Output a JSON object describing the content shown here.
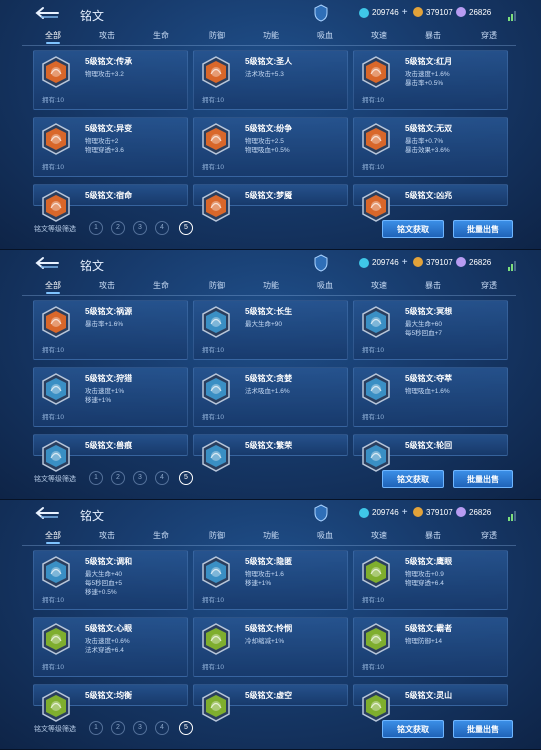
{
  "panels": [
    {
      "title": "铭文",
      "currency": {
        "coins": "209746",
        "gold": "379107",
        "gems": "26826"
      },
      "tabs": [
        "全部",
        "攻击",
        "生命",
        "防御",
        "功能",
        "吸血",
        "攻速",
        "暴击",
        "穿透"
      ],
      "runes": [
        {
          "name": "5级铭文:传承",
          "stats": [
            "物理攻击+3.2"
          ],
          "owned": "拥有:10",
          "color": "#d9672a"
        },
        {
          "name": "5级铭文:圣人",
          "stats": [
            "法术攻击+5.3"
          ],
          "owned": "拥有:10",
          "color": "#d9672a"
        },
        {
          "name": "5级铭文:红月",
          "stats": [
            "攻击速度+1.6%",
            "暴击率+0.5%"
          ],
          "owned": "拥有:10",
          "color": "#d9672a"
        },
        {
          "name": "5级铭文:异变",
          "stats": [
            "物理攻击+2",
            "物理穿透+3.6"
          ],
          "owned": "拥有:10",
          "color": "#d9672a"
        },
        {
          "name": "5级铭文:纷争",
          "stats": [
            "物理攻击+2.5",
            "物理吸血+0.5%"
          ],
          "owned": "拥有:10",
          "color": "#d9672a"
        },
        {
          "name": "5级铭文:无双",
          "stats": [
            "暴击率+0.7%",
            "暴击效果+3.6%"
          ],
          "owned": "拥有:10",
          "color": "#d9672a"
        },
        {
          "name": "5级铭文:宿命",
          "stats": [],
          "owned": "",
          "color": "#d9672a"
        },
        {
          "name": "5级铭文:梦魇",
          "stats": [],
          "owned": "",
          "color": "#d9672a"
        },
        {
          "name": "5级铭文:凶兆",
          "stats": [],
          "owned": "",
          "color": "#d9672a"
        }
      ],
      "filter_label": "铭文等级筛选",
      "levels": [
        "1",
        "2",
        "3",
        "4",
        "5"
      ],
      "btn_obtain": "铭文获取",
      "btn_sell": "批量出售"
    },
    {
      "title": "铭文",
      "currency": {
        "coins": "209746",
        "gold": "379107",
        "gems": "26826"
      },
      "tabs": [
        "全部",
        "攻击",
        "生命",
        "防御",
        "功能",
        "吸血",
        "攻速",
        "暴击",
        "穿透"
      ],
      "runes": [
        {
          "name": "5级铭文:祸源",
          "stats": [
            "暴击率+1.6%"
          ],
          "owned": "拥有:10",
          "color": "#d9672a"
        },
        {
          "name": "5级铭文:长生",
          "stats": [
            "最大生命+90"
          ],
          "owned": "拥有:10",
          "color": "#3a8fc4"
        },
        {
          "name": "5级铭文:冥想",
          "stats": [
            "最大生命+60",
            "每5秒回血+7"
          ],
          "owned": "拥有:10",
          "color": "#3a8fc4"
        },
        {
          "name": "5级铭文:狩猎",
          "stats": [
            "攻击速度+1%",
            "移速+1%"
          ],
          "owned": "拥有:10",
          "color": "#3a8fc4"
        },
        {
          "name": "5级铭文:贪婪",
          "stats": [
            "法术吸血+1.6%"
          ],
          "owned": "拥有:10",
          "color": "#3a8fc4"
        },
        {
          "name": "5级铭文:夺萃",
          "stats": [
            "物理吸血+1.6%"
          ],
          "owned": "拥有:10",
          "color": "#3a8fc4"
        },
        {
          "name": "5级铭文:兽痕",
          "stats": [],
          "owned": "",
          "color": "#3a8fc4"
        },
        {
          "name": "5级铭文:繁荣",
          "stats": [],
          "owned": "",
          "color": "#3a8fc4"
        },
        {
          "name": "5级铭文:轮回",
          "stats": [],
          "owned": "",
          "color": "#3a8fc4"
        }
      ],
      "filter_label": "铭文等级筛选",
      "levels": [
        "1",
        "2",
        "3",
        "4",
        "5"
      ],
      "btn_obtain": "铭文获取",
      "btn_sell": "批量出售"
    },
    {
      "title": "铭文",
      "currency": {
        "coins": "209746",
        "gold": "379107",
        "gems": "26826"
      },
      "tabs": [
        "全部",
        "攻击",
        "生命",
        "防御",
        "功能",
        "吸血",
        "攻速",
        "暴击",
        "穿透"
      ],
      "runes": [
        {
          "name": "5级铭文:调和",
          "stats": [
            "最大生命+40",
            "每5秒回血+5",
            "移速+0.5%"
          ],
          "owned": "拥有:10",
          "color": "#3a8fc4"
        },
        {
          "name": "5级铭文:隐匿",
          "stats": [
            "物理攻击+1.6",
            "移速+1%"
          ],
          "owned": "拥有:10",
          "color": "#3a8fc4"
        },
        {
          "name": "5级铭文:鹰眼",
          "stats": [
            "物理攻击+0.9",
            "物理穿透+6.4"
          ],
          "owned": "拥有:10",
          "color": "#7fae2e"
        },
        {
          "name": "5级铭文:心眼",
          "stats": [
            "攻击速度+0.6%",
            "法术穿透+6.4"
          ],
          "owned": "拥有:10",
          "color": "#7fae2e"
        },
        {
          "name": "5级铭文:怜悯",
          "stats": [
            "冷却缩减+1%"
          ],
          "owned": "拥有:10",
          "color": "#7fae2e"
        },
        {
          "name": "5级铭文:霸者",
          "stats": [
            "物理防御+14"
          ],
          "owned": "拥有:10",
          "color": "#7fae2e"
        },
        {
          "name": "5级铭文:均衡",
          "stats": [],
          "owned": "",
          "color": "#7fae2e"
        },
        {
          "name": "5级铭文:虚空",
          "stats": [],
          "owned": "",
          "color": "#7fae2e"
        },
        {
          "name": "5级铭文:灵山",
          "stats": [],
          "owned": "",
          "color": "#7fae2e"
        }
      ],
      "filter_label": "铭文等级筛选",
      "levels": [
        "1",
        "2",
        "3",
        "4",
        "5"
      ],
      "btn_obtain": "铭文获取",
      "btn_sell": "批量出售"
    }
  ]
}
